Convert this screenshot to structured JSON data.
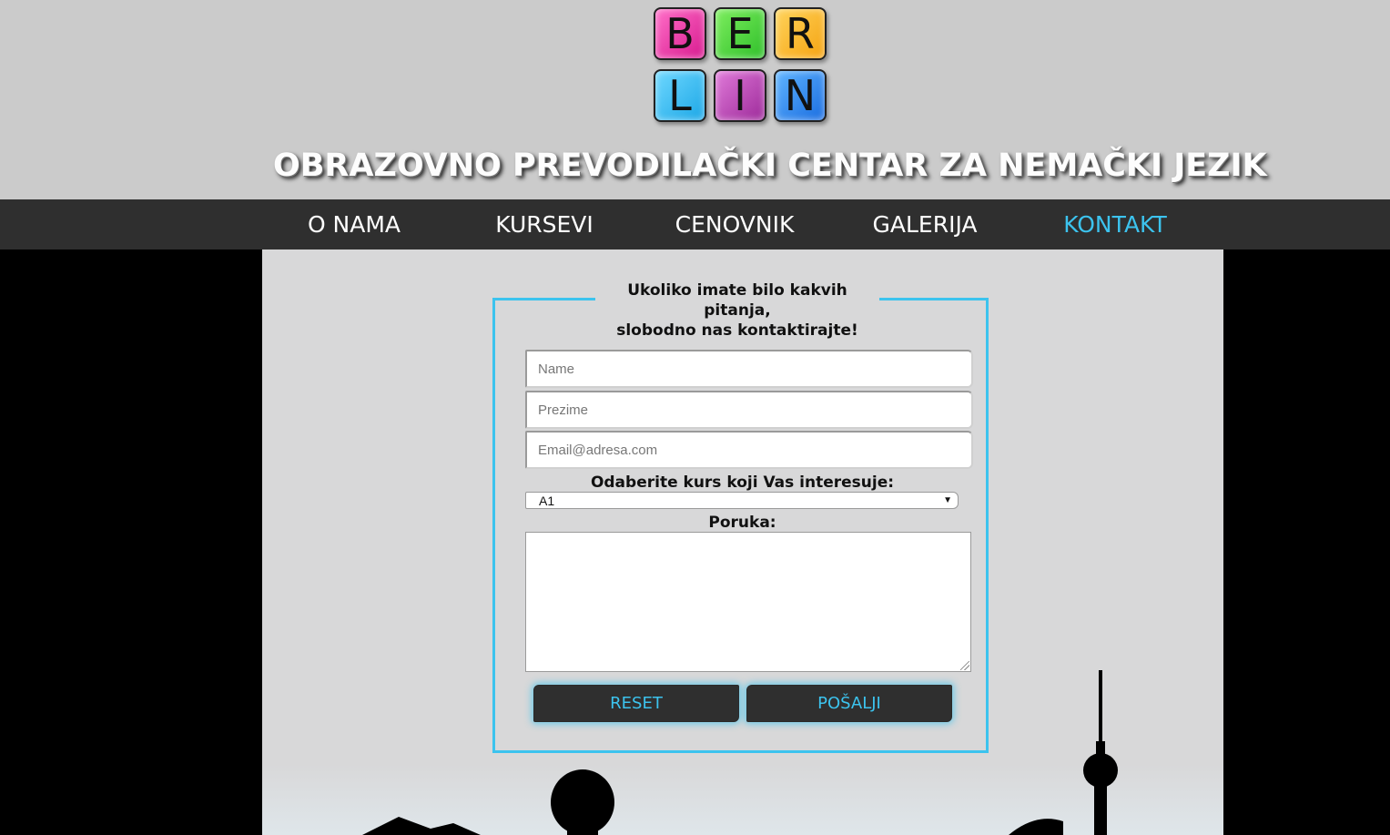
{
  "logo": {
    "letters": [
      "B",
      "E",
      "R",
      "L",
      "I",
      "N"
    ]
  },
  "header": {
    "title": "OBRAZOVNO PREVODILAČKI CENTAR ZA NEMAČKI JEZIK"
  },
  "nav": {
    "items": [
      {
        "label": "O NAMA",
        "active": false
      },
      {
        "label": "KURSEVI",
        "active": false
      },
      {
        "label": "CENOVNIK",
        "active": false
      },
      {
        "label": "GALERIJA",
        "active": false
      },
      {
        "label": "KONTAKT",
        "active": true
      }
    ]
  },
  "form": {
    "legend_line1": "Ukoliko imate bilo kakvih pitanja,",
    "legend_line2": "slobodno nas kontaktirajte!",
    "name_placeholder": "Name",
    "surname_placeholder": "Prezime",
    "email_placeholder": "Email@adresa.com",
    "course_label": "Odaberite kurs koji Vas interesuje:",
    "course_selected": "A1",
    "message_label": "Poruka:",
    "reset_label": "RESET",
    "submit_label": "POŠALJI"
  },
  "colors": {
    "accent": "#3cc3ee",
    "nav_bg": "#2f2f2f",
    "header_bg": "#cbcbcb",
    "content_bg": "#d8d8d9"
  }
}
